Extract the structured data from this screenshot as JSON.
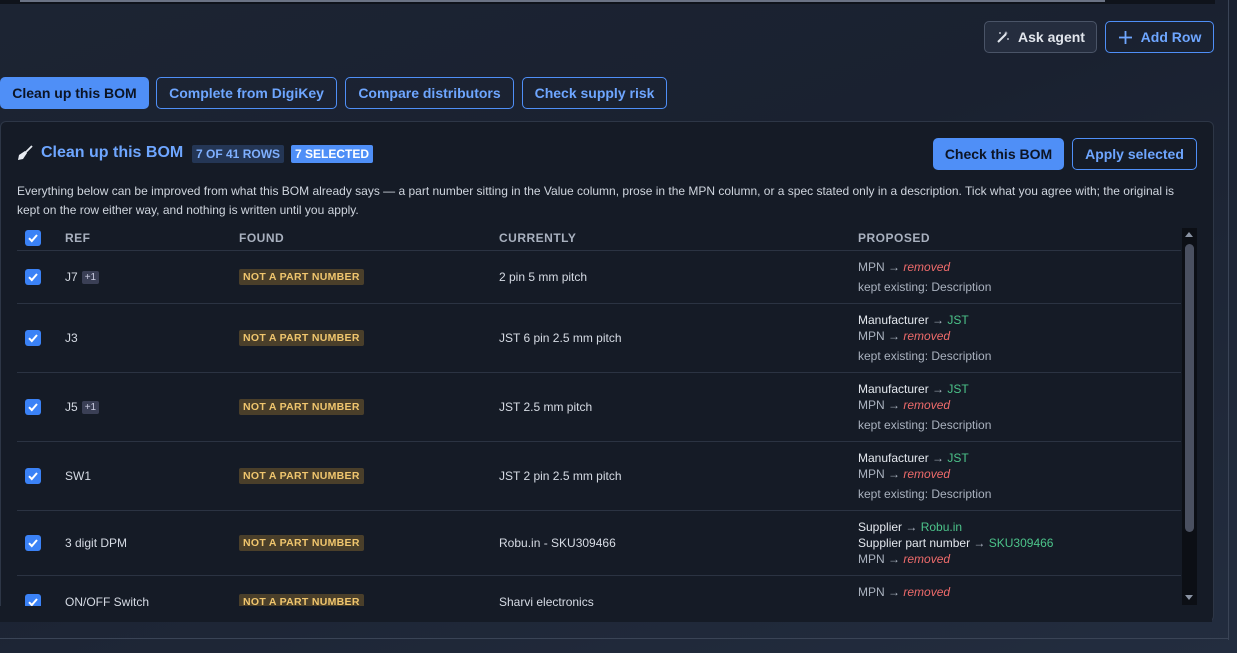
{
  "toolbar": {
    "ask_agent": "Ask agent",
    "add_row": "Add Row"
  },
  "actions": [
    {
      "label": "Clean up this BOM",
      "active": true
    },
    {
      "label": "Complete from DigiKey",
      "active": false
    },
    {
      "label": "Compare distributors",
      "active": false
    },
    {
      "label": "Check supply risk",
      "active": false
    }
  ],
  "panel": {
    "title": "Clean up this BOM",
    "rows_badge": "7 OF 41 ROWS",
    "selected_badge": "7 SELECTED",
    "check_button": "Check this BOM",
    "apply_button": "Apply selected",
    "description": "Everything below can be improved from what this BOM already says — a part number sitting in the Value column, prose in the MPN column, or a spec stated only in a description. Tick what you agree with; the original is kept on the row either way, and nothing is written until you apply."
  },
  "table": {
    "headers": {
      "ref": "REF",
      "found": "FOUND",
      "currently": "CURRENTLY",
      "proposed": "PROPOSED"
    },
    "rows": [
      {
        "ref": "J7",
        "extra": "+1",
        "found": "NOT A PART NUMBER",
        "currently": "2 pin 5 mm pitch",
        "proposed": {
          "mpn": "removed",
          "kept": "kept existing: Description"
        }
      },
      {
        "ref": "J3",
        "extra": "",
        "found": "NOT A PART NUMBER",
        "currently": "JST 6 pin 2.5 mm pitch",
        "proposed": {
          "manufacturer": "JST",
          "mpn": "removed",
          "kept": "kept existing: Description"
        }
      },
      {
        "ref": "J5",
        "extra": "+1",
        "found": "NOT A PART NUMBER",
        "currently": "JST 2.5 mm pitch",
        "proposed": {
          "manufacturer": "JST",
          "mpn": "removed",
          "kept": "kept existing: Description"
        }
      },
      {
        "ref": "SW1",
        "extra": "",
        "found": "NOT A PART NUMBER",
        "currently": "JST 2 pin 2.5 mm pitch",
        "proposed": {
          "manufacturer": "JST",
          "mpn": "removed",
          "kept": "kept existing: Description"
        }
      },
      {
        "ref": "3 digit DPM",
        "extra": "",
        "found": "NOT A PART NUMBER",
        "currently": "Robu.in - SKU309466",
        "proposed": {
          "supplier": "Robu.in",
          "supplier_pn": "SKU309466",
          "mpn": "removed"
        }
      },
      {
        "ref": "ON/OFF Switch",
        "extra": "",
        "found": "NOT A PART NUMBER",
        "currently": "Sharvi electronics",
        "proposed": {
          "mpn": "removed"
        }
      }
    ]
  },
  "field_labels": {
    "manufacturer": "Manufacturer",
    "mpn": "MPN",
    "supplier": "Supplier",
    "supplier_pn": "Supplier part number",
    "arrow": "→"
  },
  "icons": {
    "ask_agent": "magic-wand-icon",
    "add_row": "plus-icon",
    "panel": "broom-icon",
    "checkbox": "checkmark-icon"
  },
  "colors": {
    "accent": "#4f8ff7",
    "removed": "#ef6b6b",
    "added": "#4cc38a",
    "warning_tag": "#f0c66e"
  }
}
